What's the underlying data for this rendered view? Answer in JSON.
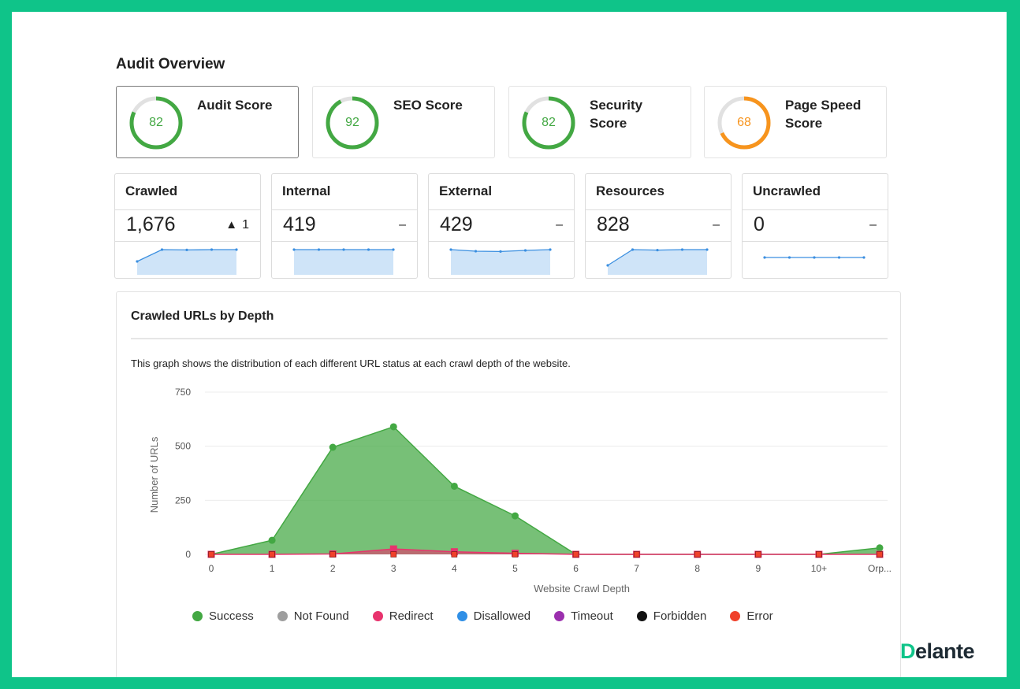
{
  "page": {
    "title": "Audit Overview"
  },
  "scores": [
    {
      "label": "Audit Score",
      "value": "82",
      "percent": 0.82,
      "color": "#43a843",
      "selected": true
    },
    {
      "label": "SEO Score",
      "value": "92",
      "percent": 0.92,
      "color": "#43a843",
      "selected": false
    },
    {
      "label": "Security Score",
      "value": "82",
      "percent": 0.82,
      "color": "#43a843",
      "selected": false
    },
    {
      "label": "Page Speed Score",
      "value": "68",
      "percent": 0.68,
      "color": "#f7941d",
      "selected": false
    }
  ],
  "stats": [
    {
      "label": "Crawled",
      "value": "1,676",
      "change_arrow": "▲",
      "change": "1",
      "trend": [
        0.25,
        1.0,
        0.98,
        1.0,
        1.0
      ]
    },
    {
      "label": "Internal",
      "value": "419",
      "change_arrow": "",
      "change": "–",
      "trend": [
        1,
        1,
        1,
        1,
        1
      ]
    },
    {
      "label": "External",
      "value": "429",
      "change_arrow": "",
      "change": "–",
      "trend": [
        1,
        0.9,
        0.88,
        0.95,
        1.0
      ]
    },
    {
      "label": "Resources",
      "value": "828",
      "change_arrow": "",
      "change": "–",
      "trend": [
        0.0,
        1.0,
        0.97,
        1.0,
        1.0
      ]
    },
    {
      "label": "Uncrawled",
      "value": "0",
      "change_arrow": "",
      "change": "–",
      "trend": [
        0,
        0,
        0,
        0,
        0
      ]
    }
  ],
  "colors": {
    "accent": "#0fc489",
    "sparkline_line": "#3b8fe0",
    "sparkline_fill": "#cfe4f8"
  },
  "chart_section": {
    "title": "Crawled URLs by Depth",
    "description": "This graph shows the distribution of each different URL status at each crawl depth of the website."
  },
  "chart_data": {
    "type": "area",
    "xlabel": "Website Crawl Depth",
    "ylabel": "Number of URLs",
    "ylim": [
      0,
      750
    ],
    "yticks": [
      0,
      250,
      500,
      750
    ],
    "categories": [
      "0",
      "1",
      "2",
      "3",
      "4",
      "5",
      "6",
      "7",
      "8",
      "9",
      "10+",
      "Orp..."
    ],
    "grid": true,
    "legend_position": "bottom",
    "series": [
      {
        "name": "Success",
        "color": "#43a843",
        "values": [
          0,
          65,
          495,
          590,
          315,
          178,
          0,
          0,
          0,
          0,
          0,
          30
        ]
      },
      {
        "name": "Not Found",
        "color": "#9e9e9e",
        "values": [
          0,
          0,
          0,
          0,
          0,
          0,
          0,
          0,
          0,
          0,
          0,
          0
        ]
      },
      {
        "name": "Redirect",
        "color": "#e8336d",
        "values": [
          0,
          0,
          2,
          25,
          12,
          5,
          0,
          0,
          0,
          0,
          0,
          0
        ]
      },
      {
        "name": "Disallowed",
        "color": "#2f8fe6",
        "values": [
          0,
          0,
          0,
          0,
          0,
          0,
          0,
          0,
          0,
          0,
          0,
          0
        ]
      },
      {
        "name": "Timeout",
        "color": "#9b2fae",
        "values": [
          0,
          0,
          0,
          0,
          0,
          0,
          0,
          0,
          0,
          0,
          0,
          0
        ]
      },
      {
        "name": "Forbidden",
        "color": "#111111",
        "values": [
          0,
          0,
          0,
          0,
          0,
          0,
          0,
          0,
          0,
          0,
          0,
          0
        ]
      },
      {
        "name": "Error",
        "color": "#f0412b",
        "values": [
          0,
          0,
          0,
          0,
          0,
          0,
          0,
          0,
          0,
          0,
          0,
          0
        ]
      }
    ]
  },
  "brand": {
    "first": "D",
    "rest": "elante"
  }
}
